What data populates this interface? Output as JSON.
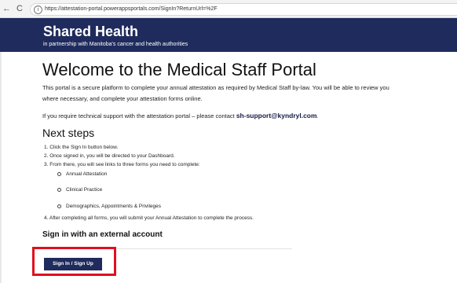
{
  "browser": {
    "back_glyph": "←",
    "reload_glyph": "C",
    "url": "https://attestation-portal.powerappsportals.com/SignIn?ReturnUrl=%2F",
    "icons": [
      "back-arrow-icon",
      "reload-icon",
      "site-info-icon"
    ]
  },
  "header": {
    "title": "Shared Health",
    "subtitle": "in partnership with Manitoba's cancer and health authorities",
    "background_color": "#1f2b5c"
  },
  "main": {
    "title": "Welcome to the Medical Staff Portal",
    "intro_line1": "This portal is a secure platform to complete your annual attestation as required by Medical Staff by-law. You will be able to review you",
    "intro_line2": "where necessary, and complete your attestation forms online.",
    "support_text": "If you require technical support with the attestation portal – please contact ",
    "support_email": "sh-support@kyndryl.com",
    "support_suffix": ".",
    "steps_title": "Next steps",
    "steps": [
      "1. Click the Sign In button below.",
      "2. Once signed in, you will be directed to your Dashboard.",
      "3. From there, you will see links to three forms you need to complete:"
    ],
    "forms": [
      "Annual Attestation",
      "Clinical Practice",
      "Demographics, Appointments & Privileges"
    ],
    "final_step": "4. After completing all forms, you will submit your Annual Attestation to complete the process.",
    "external_title": "Sign in with an external account",
    "signin_label": "Sign In / Sign Up",
    "highlight_color": "#e0101c"
  }
}
